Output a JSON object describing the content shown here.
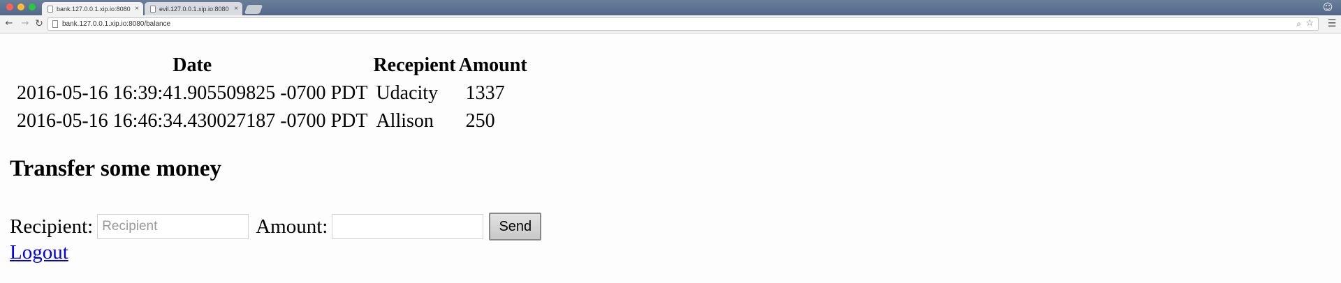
{
  "browser": {
    "tabs": [
      {
        "title": "bank.127.0.0.1.xip.io:8080",
        "close": "×"
      },
      {
        "title": "evil.127.0.0.1.xip.io:8080",
        "close": "×"
      }
    ],
    "url": "bank.127.0.0.1.xip.io:8080/balance"
  },
  "transactions": {
    "headers": {
      "date": "Date",
      "recipient": "Recepient",
      "amount": "Amount"
    },
    "rows": [
      {
        "date": "2016-05-16 16:39:41.905509825 -0700 PDT",
        "recipient": "Udacity",
        "amount": "1337"
      },
      {
        "date": "2016-05-16 16:46:34.430027187 -0700 PDT",
        "recipient": "Allison",
        "amount": "250"
      }
    ]
  },
  "transfer": {
    "heading": "Transfer some money",
    "recipient_label": "Recipient:",
    "recipient_placeholder": "Recipient",
    "amount_label": "Amount:",
    "amount_value": "",
    "send_label": "Send"
  },
  "logout_label": "Logout"
}
